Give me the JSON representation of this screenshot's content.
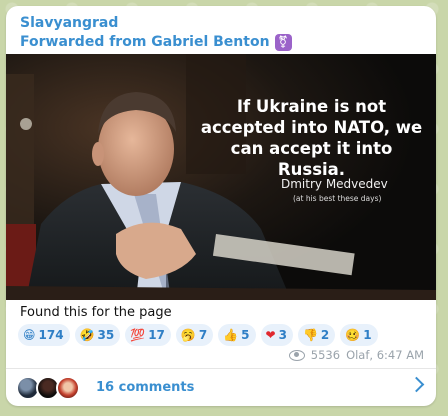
{
  "post": {
    "channel": "Slavyangrad",
    "forwarded": "Forwarded from Gabriel Benton",
    "forward_badge": "⚧"
  },
  "image": {
    "quote": "If Ukraine is not accepted into NATO, we can accept it into Russia.",
    "author": "Dmitry Medvedev",
    "author_sub": "(at his best these days)"
  },
  "message": "Found this for the page",
  "reactions": [
    {
      "emoji": "😁",
      "count": "174"
    },
    {
      "emoji": "🤣",
      "count": "35"
    },
    {
      "emoji": "💯",
      "count": "17"
    },
    {
      "emoji": "🥱",
      "count": "7"
    },
    {
      "emoji": "👍",
      "count": "5"
    },
    {
      "emoji": "❤",
      "count": "3"
    },
    {
      "emoji": "👎",
      "count": "2"
    },
    {
      "emoji": "🥴",
      "count": "1"
    }
  ],
  "meta": {
    "views": "5536",
    "signature": "Olaf, 6:47 AM"
  },
  "comments": {
    "label": "16 comments"
  },
  "colors": {
    "accent": "#3a8fd0",
    "reaction_bg": "#e8f1fb",
    "background": "#c9d6a9"
  }
}
